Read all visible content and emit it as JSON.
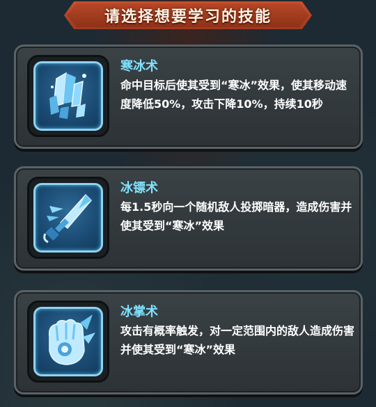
{
  "header": {
    "title": "请选择想要学习的技能"
  },
  "skills": [
    {
      "name": "寒冰术",
      "description": "命中目标后使其受到“寒冰”效果，使其移动速度降低50%，攻击下降10%，持续10秒",
      "icon": "ice-crystal-icon"
    },
    {
      "name": "冰镖术",
      "description": "每1.5秒向一个随机敌人投掷暗器，造成伤害并使其受到“寒冰”效果",
      "icon": "ice-dagger-icon"
    },
    {
      "name": "冰掌术",
      "description": "攻击有概率触发，对一定范围内的敌人造成伤害并使其受到“寒冰”效果",
      "icon": "ice-palm-icon"
    }
  ],
  "colors": {
    "banner": "#b64726",
    "skill_name": "#7fe3ff",
    "card_bg": "#3b4246",
    "icon_border": "#8fd2f0"
  }
}
